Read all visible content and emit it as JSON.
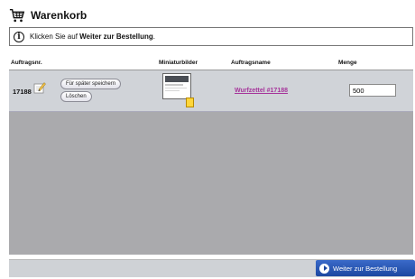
{
  "header": {
    "title": "Warenkorb",
    "icon": "shopping-cart-icon"
  },
  "info": {
    "icon": "info-icon",
    "text_before": "Klicken Sie auf ",
    "text_bold": "Weiter zur Bestellung",
    "text_after": "."
  },
  "columns": {
    "order_no": "Auftragsnr.",
    "thumbnails": "Miniaturbilder",
    "job_name": "Auftragsname",
    "quantity": "Menge"
  },
  "row": {
    "order_no": "17188",
    "save_later": "Für später speichern",
    "delete": "Löschen",
    "job_name": "Wurfzettel #17188",
    "quantity": "500"
  },
  "footer": {
    "proceed": "Weiter zur Bestellung"
  },
  "colors": {
    "link": "#a6359b",
    "button": "#1c47a1",
    "grey_area": "#aaaaad"
  }
}
